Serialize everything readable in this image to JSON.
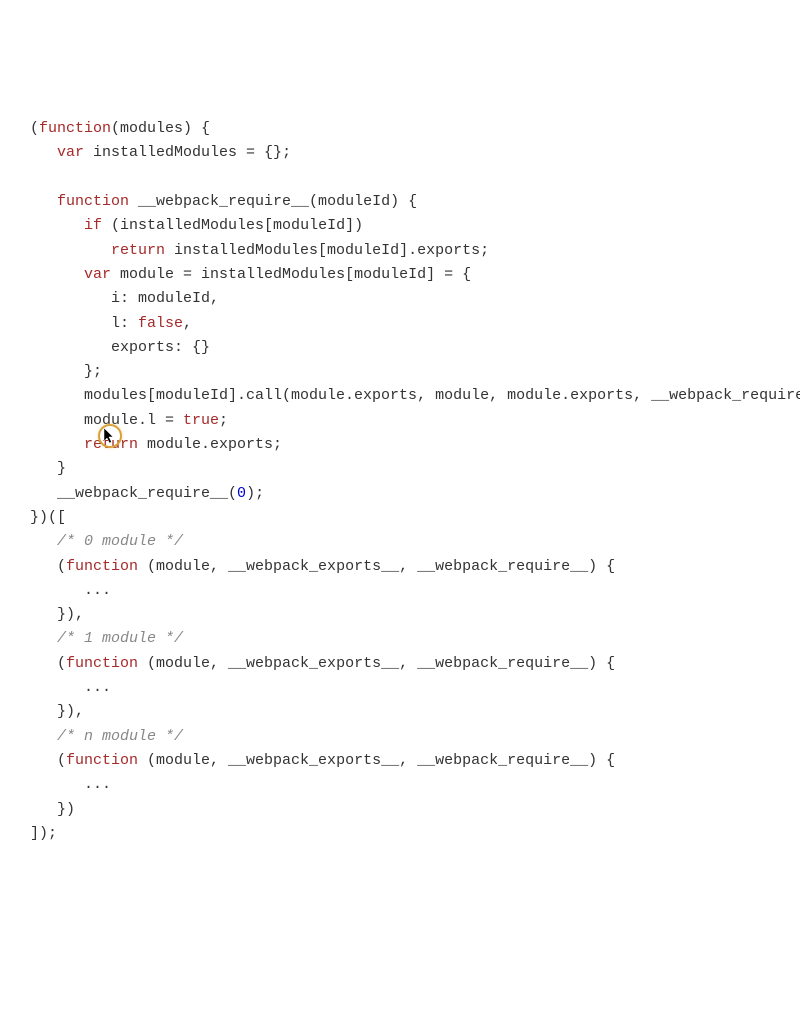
{
  "code": {
    "tokens": [
      {
        "cls": "punct",
        "text": "("
      },
      {
        "cls": "kw",
        "text": "function"
      },
      {
        "cls": "punct",
        "text": "(modules) {\n"
      },
      {
        "cls": "punct",
        "text": "   "
      },
      {
        "cls": "kw",
        "text": "var"
      },
      {
        "cls": "punct",
        "text": " installedModules = {};\n"
      },
      {
        "cls": "punct",
        "text": "\n"
      },
      {
        "cls": "punct",
        "text": "   "
      },
      {
        "cls": "kw",
        "text": "function"
      },
      {
        "cls": "punct",
        "text": " __webpack_require__(moduleId) {\n"
      },
      {
        "cls": "punct",
        "text": "      "
      },
      {
        "cls": "kw",
        "text": "if"
      },
      {
        "cls": "punct",
        "text": " (installedModules[moduleId])\n"
      },
      {
        "cls": "punct",
        "text": "         "
      },
      {
        "cls": "kw",
        "text": "return"
      },
      {
        "cls": "punct",
        "text": " installedModules[moduleId].exports;\n"
      },
      {
        "cls": "punct",
        "text": "      "
      },
      {
        "cls": "kw",
        "text": "var"
      },
      {
        "cls": "punct",
        "text": " module = installedModules[moduleId] = {\n"
      },
      {
        "cls": "punct",
        "text": "         i: moduleId,\n"
      },
      {
        "cls": "punct",
        "text": "         l: "
      },
      {
        "cls": "kw",
        "text": "false"
      },
      {
        "cls": "punct",
        "text": ",\n"
      },
      {
        "cls": "punct",
        "text": "         exports: {}\n"
      },
      {
        "cls": "punct",
        "text": "      };\n"
      },
      {
        "cls": "punct",
        "text": "      modules[moduleId].call(module.exports, module, module.exports, __webpack_require__);\n"
      },
      {
        "cls": "punct",
        "text": "      module.l = "
      },
      {
        "cls": "kw",
        "text": "true"
      },
      {
        "cls": "punct",
        "text": ";\n"
      },
      {
        "cls": "punct",
        "text": "      "
      },
      {
        "cls": "kw",
        "text": "return"
      },
      {
        "cls": "punct",
        "text": " module.exports;\n"
      },
      {
        "cls": "punct",
        "text": "   }\n"
      },
      {
        "cls": "punct",
        "text": "   __webpack_require__("
      },
      {
        "cls": "num",
        "text": "0"
      },
      {
        "cls": "punct",
        "text": ");\n"
      },
      {
        "cls": "punct",
        "text": "})([\n"
      },
      {
        "cls": "punct",
        "text": "   "
      },
      {
        "cls": "comment",
        "text": "/* 0 module */"
      },
      {
        "cls": "punct",
        "text": "\n"
      },
      {
        "cls": "punct",
        "text": "   ("
      },
      {
        "cls": "kw",
        "text": "function"
      },
      {
        "cls": "punct",
        "text": " (module, __webpack_exports__, __webpack_require__) {\n"
      },
      {
        "cls": "punct",
        "text": "      ...\n"
      },
      {
        "cls": "punct",
        "text": "   }),\n"
      },
      {
        "cls": "punct",
        "text": "   "
      },
      {
        "cls": "comment",
        "text": "/* 1 module */"
      },
      {
        "cls": "punct",
        "text": "\n"
      },
      {
        "cls": "punct",
        "text": "   ("
      },
      {
        "cls": "kw",
        "text": "function"
      },
      {
        "cls": "punct",
        "text": " (module, __webpack_exports__, __webpack_require__) {\n"
      },
      {
        "cls": "punct",
        "text": "      ...\n"
      },
      {
        "cls": "punct",
        "text": "   }),\n"
      },
      {
        "cls": "punct",
        "text": "   "
      },
      {
        "cls": "comment",
        "text": "/* n module */"
      },
      {
        "cls": "punct",
        "text": "\n"
      },
      {
        "cls": "punct",
        "text": "   ("
      },
      {
        "cls": "kw",
        "text": "function"
      },
      {
        "cls": "punct",
        "text": " (module, __webpack_exports__, __webpack_require__) {\n"
      },
      {
        "cls": "punct",
        "text": "      ...\n"
      },
      {
        "cls": "punct",
        "text": "   })\n"
      },
      {
        "cls": "punct",
        "text": "]);"
      }
    ]
  },
  "cursor": {
    "present": true
  }
}
